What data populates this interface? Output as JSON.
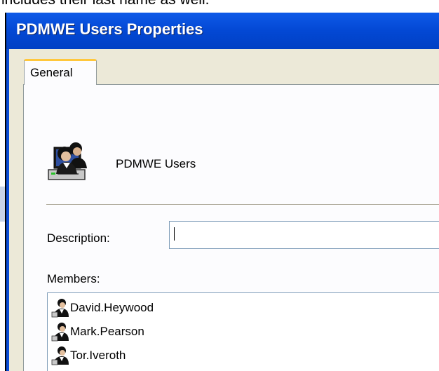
{
  "document": {
    "text": "includes their last name as well."
  },
  "dialog": {
    "title": "PDMWE Users Properties",
    "tabs": [
      {
        "label": "General",
        "active": true
      }
    ],
    "group": {
      "name": "PDMWE Users",
      "icon": "user-group-icon"
    },
    "description": {
      "label": "Description:",
      "value": ""
    },
    "members": {
      "label": "Members:",
      "items": [
        {
          "name": "David.Heywood",
          "icon": "user-icon"
        },
        {
          "name": "Mark.Pearson",
          "icon": "user-icon"
        },
        {
          "name": "Tor.Iveroth",
          "icon": "user-icon"
        }
      ]
    }
  },
  "colors": {
    "titlebar": "#0348d4",
    "dialog_bg": "#ece9d8",
    "tab_highlight": "#ffc73c",
    "input_border": "#7f9db9"
  }
}
